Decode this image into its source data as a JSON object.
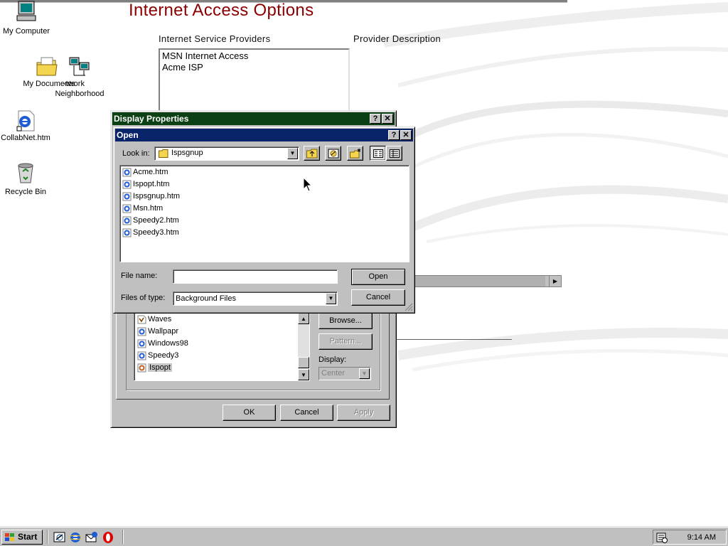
{
  "desktop": {
    "icons": [
      {
        "label": "My Computer",
        "icon": "computer-icon"
      },
      {
        "label": "My Documents",
        "icon": "folder-icon"
      },
      {
        "label": "Network Neighborhood",
        "label_line1": "·twork",
        "label_line2": "Neighborhood",
        "icon": "network-icon"
      },
      {
        "label": "CollabNet.htm",
        "icon": "ie-document-icon"
      },
      {
        "label": "Recycle Bin",
        "icon": "recycle-bin-icon"
      }
    ]
  },
  "page": {
    "title": "Internet Access Options",
    "isp_label": "Internet Service Providers",
    "desc_label": "Provider Description",
    "providers": [
      "MSN Internet Access",
      "Acme ISP"
    ]
  },
  "display_properties": {
    "title": "Display Properties",
    "wallpapers": [
      "Waves",
      "Wallpapr",
      "Windows98",
      "Speedy3",
      "Ispopt"
    ],
    "browse_label": "Browse...",
    "pattern_label": "Pattern...",
    "display_label": "Display:",
    "display_value": "Center",
    "ok_label": "OK",
    "cancel_label": "Cancel",
    "apply_label": "Apply"
  },
  "open_dialog": {
    "title": "Open",
    "look_in_label": "Look in:",
    "look_in_value": "Ispsgnup",
    "files": [
      "Acme.htm",
      "Ispopt.htm",
      "Ispsgnup.htm",
      "Msn.htm",
      "Speedy2.htm",
      "Speedy3.htm"
    ],
    "file_name_label": "File name:",
    "file_name_value": "",
    "files_of_type_label": "Files of type:",
    "files_of_type_value": "Background Files",
    "open_label": "Open",
    "cancel_label": "Cancel"
  },
  "taskbar": {
    "start_label": "Start",
    "clock": "9:14 AM"
  },
  "colors": {
    "active_title": "#0a246a",
    "inactive_title": "#0b3f14",
    "page_title": "#8b0000"
  }
}
